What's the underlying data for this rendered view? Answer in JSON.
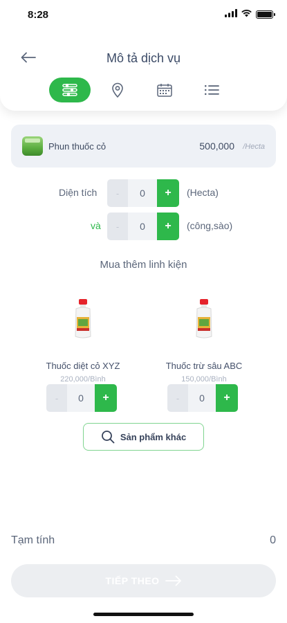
{
  "status_bar": {
    "time": "8:28"
  },
  "header": {
    "title": "Mô tả dịch vụ"
  },
  "tabs": [
    {
      "icon": "sliders-icon",
      "active": true
    },
    {
      "icon": "location-pin-icon",
      "active": false
    },
    {
      "icon": "calendar-icon",
      "active": false
    },
    {
      "icon": "list-icon",
      "active": false
    }
  ],
  "service": {
    "name": "Phun thuốc cỏ",
    "price": "500,000",
    "unit": "/Hecta"
  },
  "area": {
    "label": "Diện tích",
    "value": "0",
    "unit": "(Hecta)",
    "and_label": "và",
    "value2": "0",
    "unit2": "(công,sào)",
    "minus": "-",
    "plus": "+"
  },
  "accessories": {
    "title": "Mua thêm linh kiện",
    "products": [
      {
        "name": "Thuốc diệt cỏ XYZ",
        "price": "220,000/Bình",
        "qty": "0"
      },
      {
        "name": "Thuốc trừ sâu ABC",
        "price": "150,000/Bình",
        "qty": "0"
      }
    ],
    "more_label": "Sản phẩm khác"
  },
  "summary": {
    "label": "Tạm tính",
    "value": "0"
  },
  "next_button": {
    "label": "TIẾP THEO"
  },
  "colors": {
    "accent": "#2eb84b",
    "text": "#5b667a",
    "disabled": "#eceef1"
  }
}
